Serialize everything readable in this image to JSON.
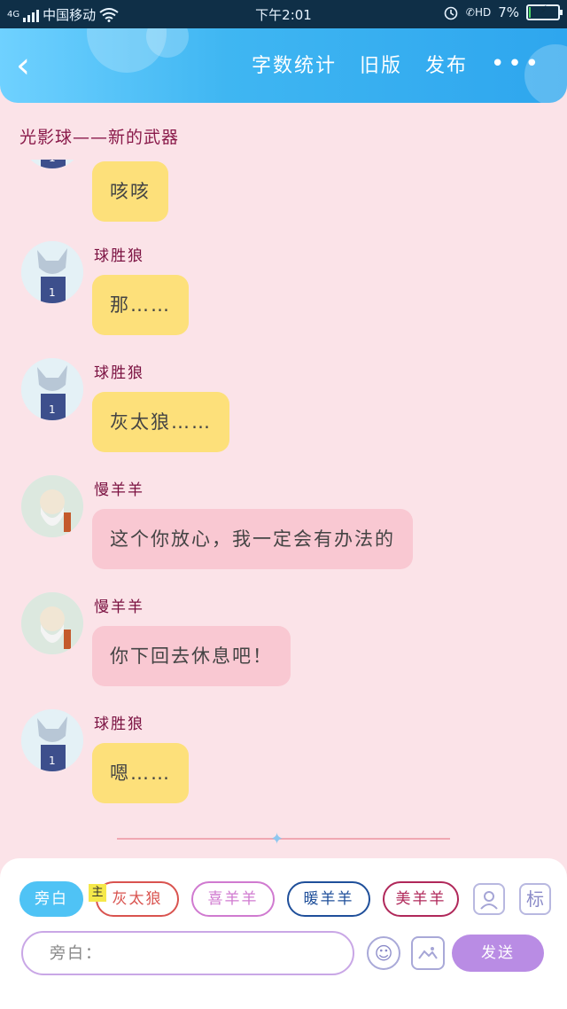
{
  "status_bar": {
    "network": "4G",
    "carrier": "中国移动",
    "time": "下午2:01",
    "hd_label": "HD",
    "battery_percent": "7%",
    "battery_level": 0.07
  },
  "header": {
    "actions": [
      "字数统计",
      "旧版",
      "发布"
    ],
    "more": "•••",
    "back": "‹"
  },
  "document_title": "光影球——新的武器",
  "messages": [
    {
      "speaker": "",
      "text": "咳咳",
      "avatar": "wolf-avatar",
      "bubble_color": "#fde07a"
    },
    {
      "speaker": "球胜狼",
      "text": "那……",
      "avatar": "wolf-avatar",
      "bubble_color": "#fde07a"
    },
    {
      "speaker": "球胜狼",
      "text": "灰太狼……",
      "avatar": "wolf-avatar",
      "bubble_color": "#fde07a"
    },
    {
      "speaker": "慢羊羊",
      "text": "这个你放心，我一定会有办法的",
      "avatar": "elder-goat-avatar",
      "bubble_color": "#f9c8d2"
    },
    {
      "speaker": "慢羊羊",
      "text": "你下回去休息吧！",
      "avatar": "elder-goat-avatar",
      "bubble_color": "#f9c8d2"
    },
    {
      "speaker": "球胜狼",
      "text": "嗯……",
      "avatar": "wolf-avatar",
      "bubble_color": "#fde07a"
    }
  ],
  "roles": [
    {
      "label": "旁白",
      "active": true,
      "color": "#4fc3f5"
    },
    {
      "label": "灰太狼",
      "active": false,
      "color": "#d9534f"
    },
    {
      "label": "喜羊羊",
      "active": false,
      "color": "#d07ad0"
    },
    {
      "label": "暖羊羊",
      "active": false,
      "color": "#1f4f9a"
    },
    {
      "label": "美羊羊",
      "active": false,
      "color": "#b0285a"
    }
  ],
  "main_badge": "主",
  "tool_buttons": {
    "add_role_icon": "person-icon",
    "label_button": "标"
  },
  "input": {
    "placeholder": "旁白：",
    "value": ""
  },
  "send_label": "发送",
  "colors": {
    "accent": "#2ea6ee",
    "send": "#b98ce4",
    "background": "#fbe3e8"
  }
}
